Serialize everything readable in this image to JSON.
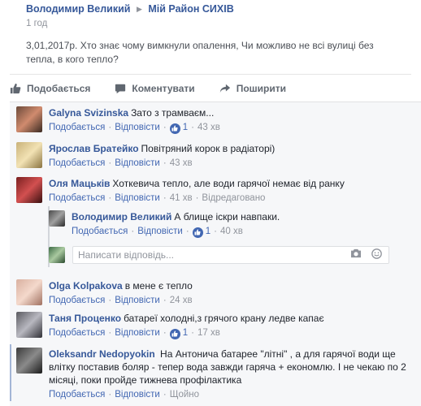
{
  "post": {
    "author": "Володимир Великий",
    "group": "Мій Район СИХІВ",
    "time": "1 год",
    "body": "3,01,2017р. Хто знає чому вимкнули опалення, Чи можливо не всі вулиці без тепла, в кого тепло?"
  },
  "actions": {
    "like": "Подобається",
    "comment": "Коментувати",
    "share": "Поширити"
  },
  "meta": {
    "like": "Подобається",
    "reply": "Відповісти",
    "edited": "Відредаговано",
    "dot": "·"
  },
  "comments": [
    {
      "author": "Galyna Svizinska",
      "text": "Зато з трамваєм...",
      "likes": "1",
      "time": "43 хв"
    },
    {
      "author": "Ярослав Братейко",
      "text": "Повітряний корок в радіаторі)",
      "time": "43 хв"
    },
    {
      "author": "Оля Мацьків",
      "text": "Хоткевича тепло, але води гарячої немає від ранку",
      "time": "41 хв"
    },
    {
      "author": "Володимир Великий",
      "text": "А блище іскри навпаки.",
      "likes": "1",
      "time": "40 хв"
    },
    {
      "author": "Olga Kolpakova",
      "text": "в мене є тепло",
      "time": "24 хв"
    },
    {
      "author": "Таня Проценко",
      "text": "батареї холодні,з грячого крану ледве капає",
      "likes": "1",
      "time": "17 хв"
    },
    {
      "author": "Oleksandr Nedopyokin",
      "text": "На Антонича батарее \"літні\" , а для гарячої води ще влітку поставив боляр - тепер вода завжди гаряча + економлю. І не чекаю по 2 місяці, поки пройде тижнева профілактика",
      "time": "Щойно"
    }
  ],
  "reply_box": {
    "placeholder": "Написати відповідь..."
  },
  "colors": {
    "link": "#365899",
    "meta": "#90949c",
    "accent": "#4267b2",
    "panel": "#f6f7f9"
  },
  "icons": [
    "thumbs-up-icon",
    "comment-icon",
    "share-icon",
    "camera-icon",
    "smiley-icon",
    "triangle-right-icon",
    "like-badge-icon"
  ]
}
